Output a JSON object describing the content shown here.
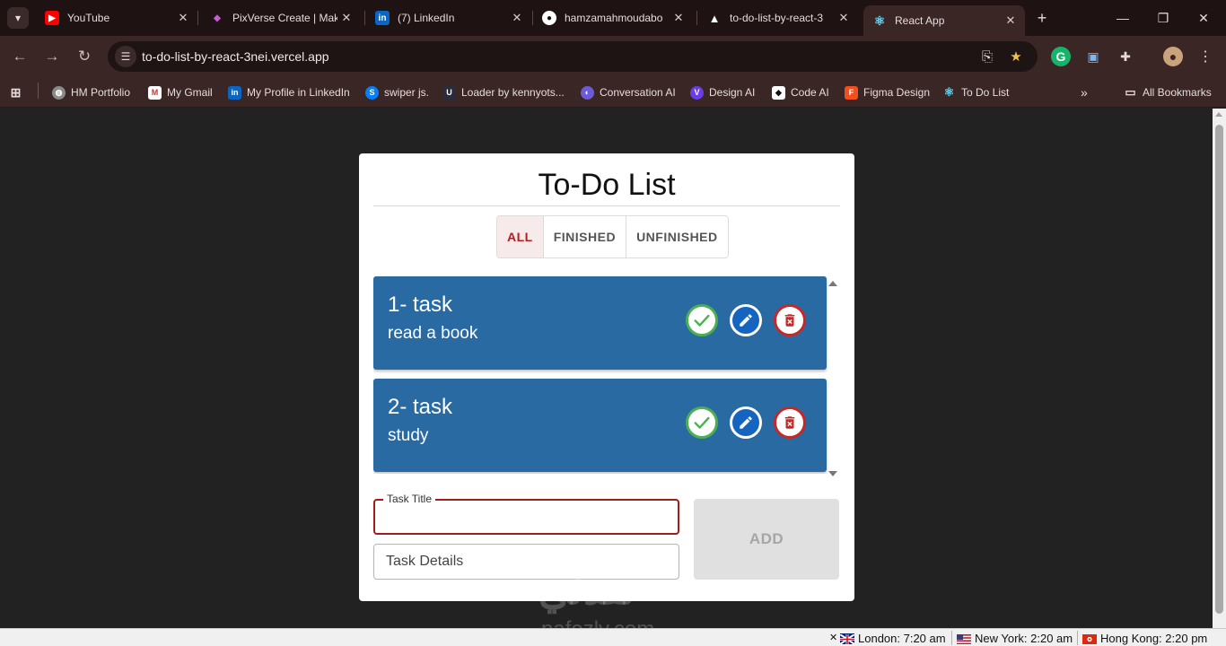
{
  "browser": {
    "tabs": [
      {
        "label": "YouTube",
        "icon": "youtube-icon",
        "favicon_color": "#ff0000"
      },
      {
        "label": "PixVerse Create | Mak",
        "icon": "pixverse-icon",
        "favicon_color": "#c85ad8"
      },
      {
        "label": "(7) LinkedIn",
        "icon": "linkedin-icon",
        "favicon_color": "#0a66c2"
      },
      {
        "label": "hamzamahmoudabo",
        "icon": "github-icon",
        "favicon_color": "#ffffff"
      },
      {
        "label": "to-do-list-by-react-3",
        "icon": "vercel-icon",
        "favicon_color": "#ffffff"
      },
      {
        "label": "React App",
        "icon": "react-icon",
        "favicon_color": "#61dafb",
        "active": true
      }
    ],
    "url": "to-do-list-by-react-3nei.vercel.app",
    "bookmarks": [
      {
        "label": "HM Portfolio",
        "icon": "globe-icon"
      },
      {
        "label": "My Gmail",
        "icon": "gmail-icon"
      },
      {
        "label": "My Profile in LinkedIn",
        "icon": "linkedin-icon"
      },
      {
        "label": "swiper js.",
        "icon": "swiper-icon"
      },
      {
        "label": "Loader by kennyots...",
        "icon": "uiverse-icon"
      },
      {
        "label": "Conversation AI",
        "icon": "conversation-ai-icon"
      },
      {
        "label": "Design AI",
        "icon": "design-ai-icon"
      },
      {
        "label": "Code AI",
        "icon": "code-ai-icon"
      },
      {
        "label": "Figma Design",
        "icon": "figma-icon"
      },
      {
        "label": "To Do List",
        "icon": "react-icon"
      }
    ],
    "all_bookmarks_label": "All Bookmarks"
  },
  "app": {
    "title": "To-Do List",
    "filters": [
      {
        "label": "ALL",
        "selected": true
      },
      {
        "label": "FINISHED",
        "selected": false
      },
      {
        "label": "UNFINISHED",
        "selected": false
      }
    ],
    "tasks": [
      {
        "title": "1- task",
        "details": "read a book"
      },
      {
        "title": "2- task",
        "details": "study"
      }
    ],
    "form": {
      "title_label": "Task Title",
      "title_value": "",
      "details_placeholder": "Task Details",
      "add_label": "ADD"
    },
    "colors": {
      "task_bg": "#2a6aa3",
      "accent": "#b71c1c",
      "check": "#4caf50",
      "edit": "#1565c0",
      "delete": "#c62828"
    }
  },
  "watermark": {
    "arabic": "نفذلي",
    "latin": "nafezly.com"
  },
  "clocks": [
    {
      "label": "London: 7:20 am",
      "flag": "uk-flag-icon"
    },
    {
      "label": "New York: 2:20 am",
      "flag": "us-flag-icon"
    },
    {
      "label": "Hong Kong: 2:20 pm",
      "flag": "hk-flag-icon"
    }
  ]
}
